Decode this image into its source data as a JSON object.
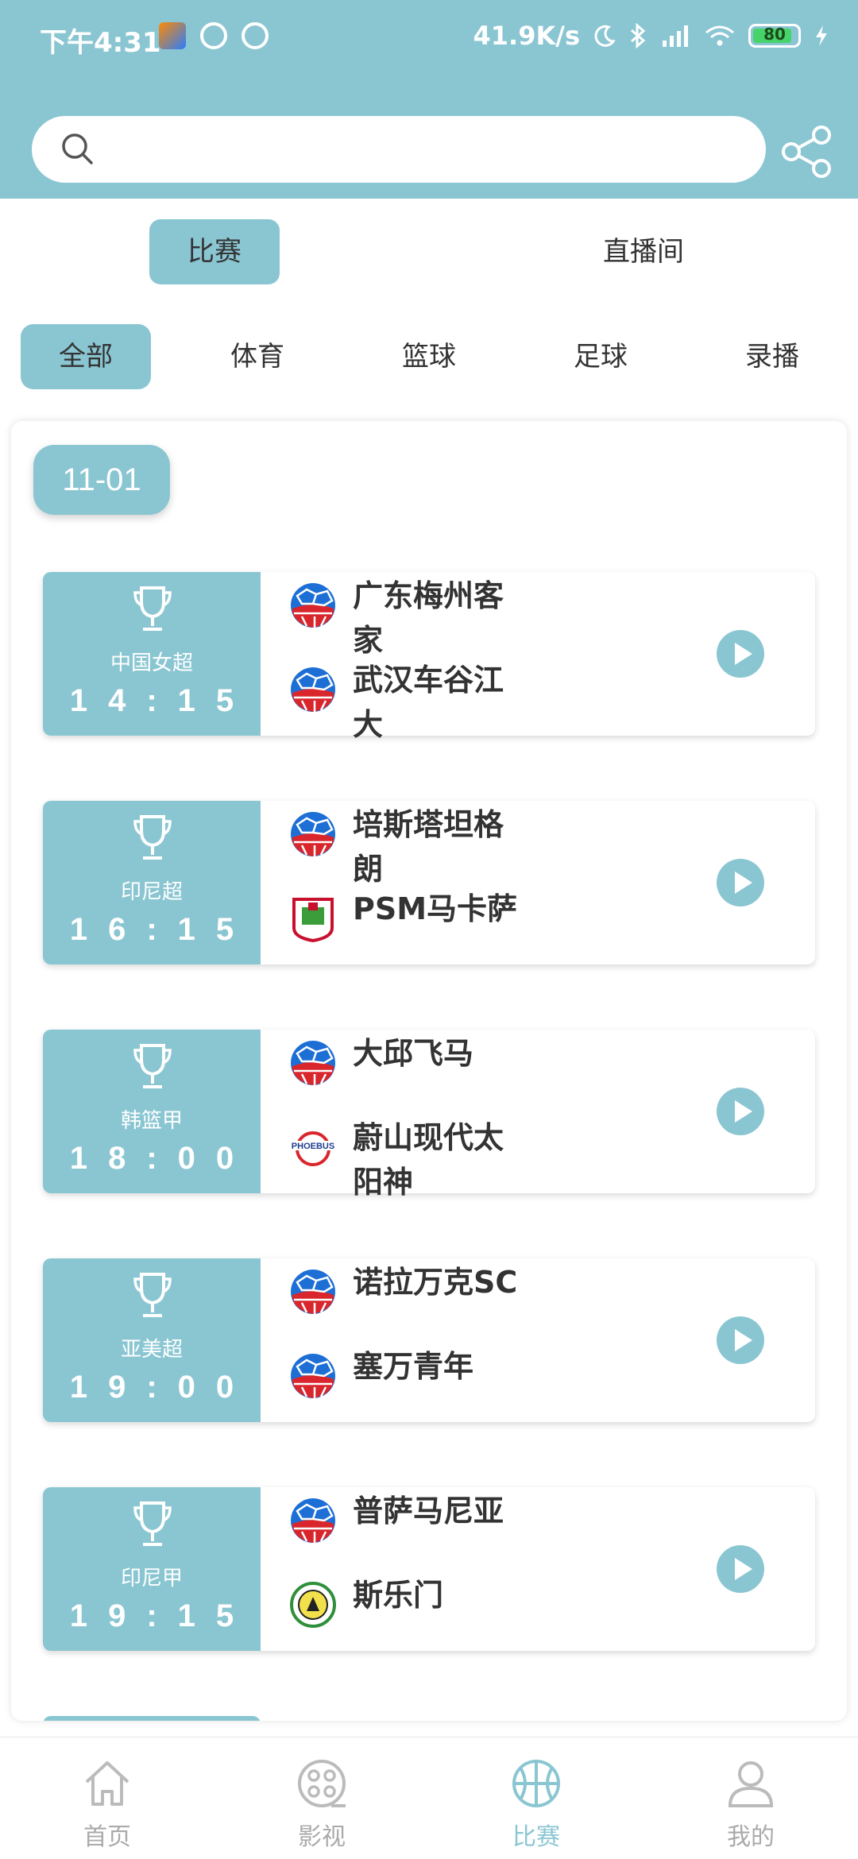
{
  "status_bar": {
    "time": "下午4:31",
    "net_speed": "41.9K/s",
    "battery": "80"
  },
  "search": {
    "placeholder": "",
    "value": ""
  },
  "tabs": [
    {
      "label": "比赛",
      "active": true
    },
    {
      "label": "直播间",
      "active": false
    }
  ],
  "categories": [
    {
      "label": "全部",
      "active": true
    },
    {
      "label": "体育",
      "active": false
    },
    {
      "label": "篮球",
      "active": false
    },
    {
      "label": "足球",
      "active": false
    },
    {
      "label": "录播",
      "active": false
    }
  ],
  "date": "11-01",
  "matches": [
    {
      "league": "中国女超",
      "time": "14:15",
      "home": "广东梅州客家",
      "away": "武汉车谷江大",
      "home_logo": "generic-ball",
      "away_logo": "generic-ball"
    },
    {
      "league": "印尼超",
      "time": "16:15",
      "home": "培斯塔坦格朗",
      "away": "PSM马卡萨",
      "home_logo": "generic-ball",
      "away_logo": "psm-crest"
    },
    {
      "league": "韩篮甲",
      "time": "18:00",
      "home": "大邱飞马",
      "away": "蔚山现代太阳神",
      "home_logo": "generic-ball",
      "away_logo": "phoebus-logo"
    },
    {
      "league": "亚美超",
      "time": "19:00",
      "home": "诺拉万克SC",
      "away": "塞万青年",
      "home_logo": "generic-ball",
      "away_logo": "generic-ball"
    },
    {
      "league": "印尼甲",
      "time": "19:15",
      "home": "普萨马尼亚",
      "away": "斯乐门",
      "home_logo": "generic-ball",
      "away_logo": "round-crest"
    }
  ],
  "bottom_nav": [
    {
      "label": "首页",
      "icon": "home-icon",
      "active": false
    },
    {
      "label": "影视",
      "icon": "film-reel-icon",
      "active": false
    },
    {
      "label": "比赛",
      "icon": "basketball-icon",
      "active": true
    },
    {
      "label": "我的",
      "icon": "user-icon",
      "active": false
    }
  ],
  "colors": {
    "accent": "#8ac6d2",
    "text": "#333333",
    "muted": "#aaaaaa"
  }
}
